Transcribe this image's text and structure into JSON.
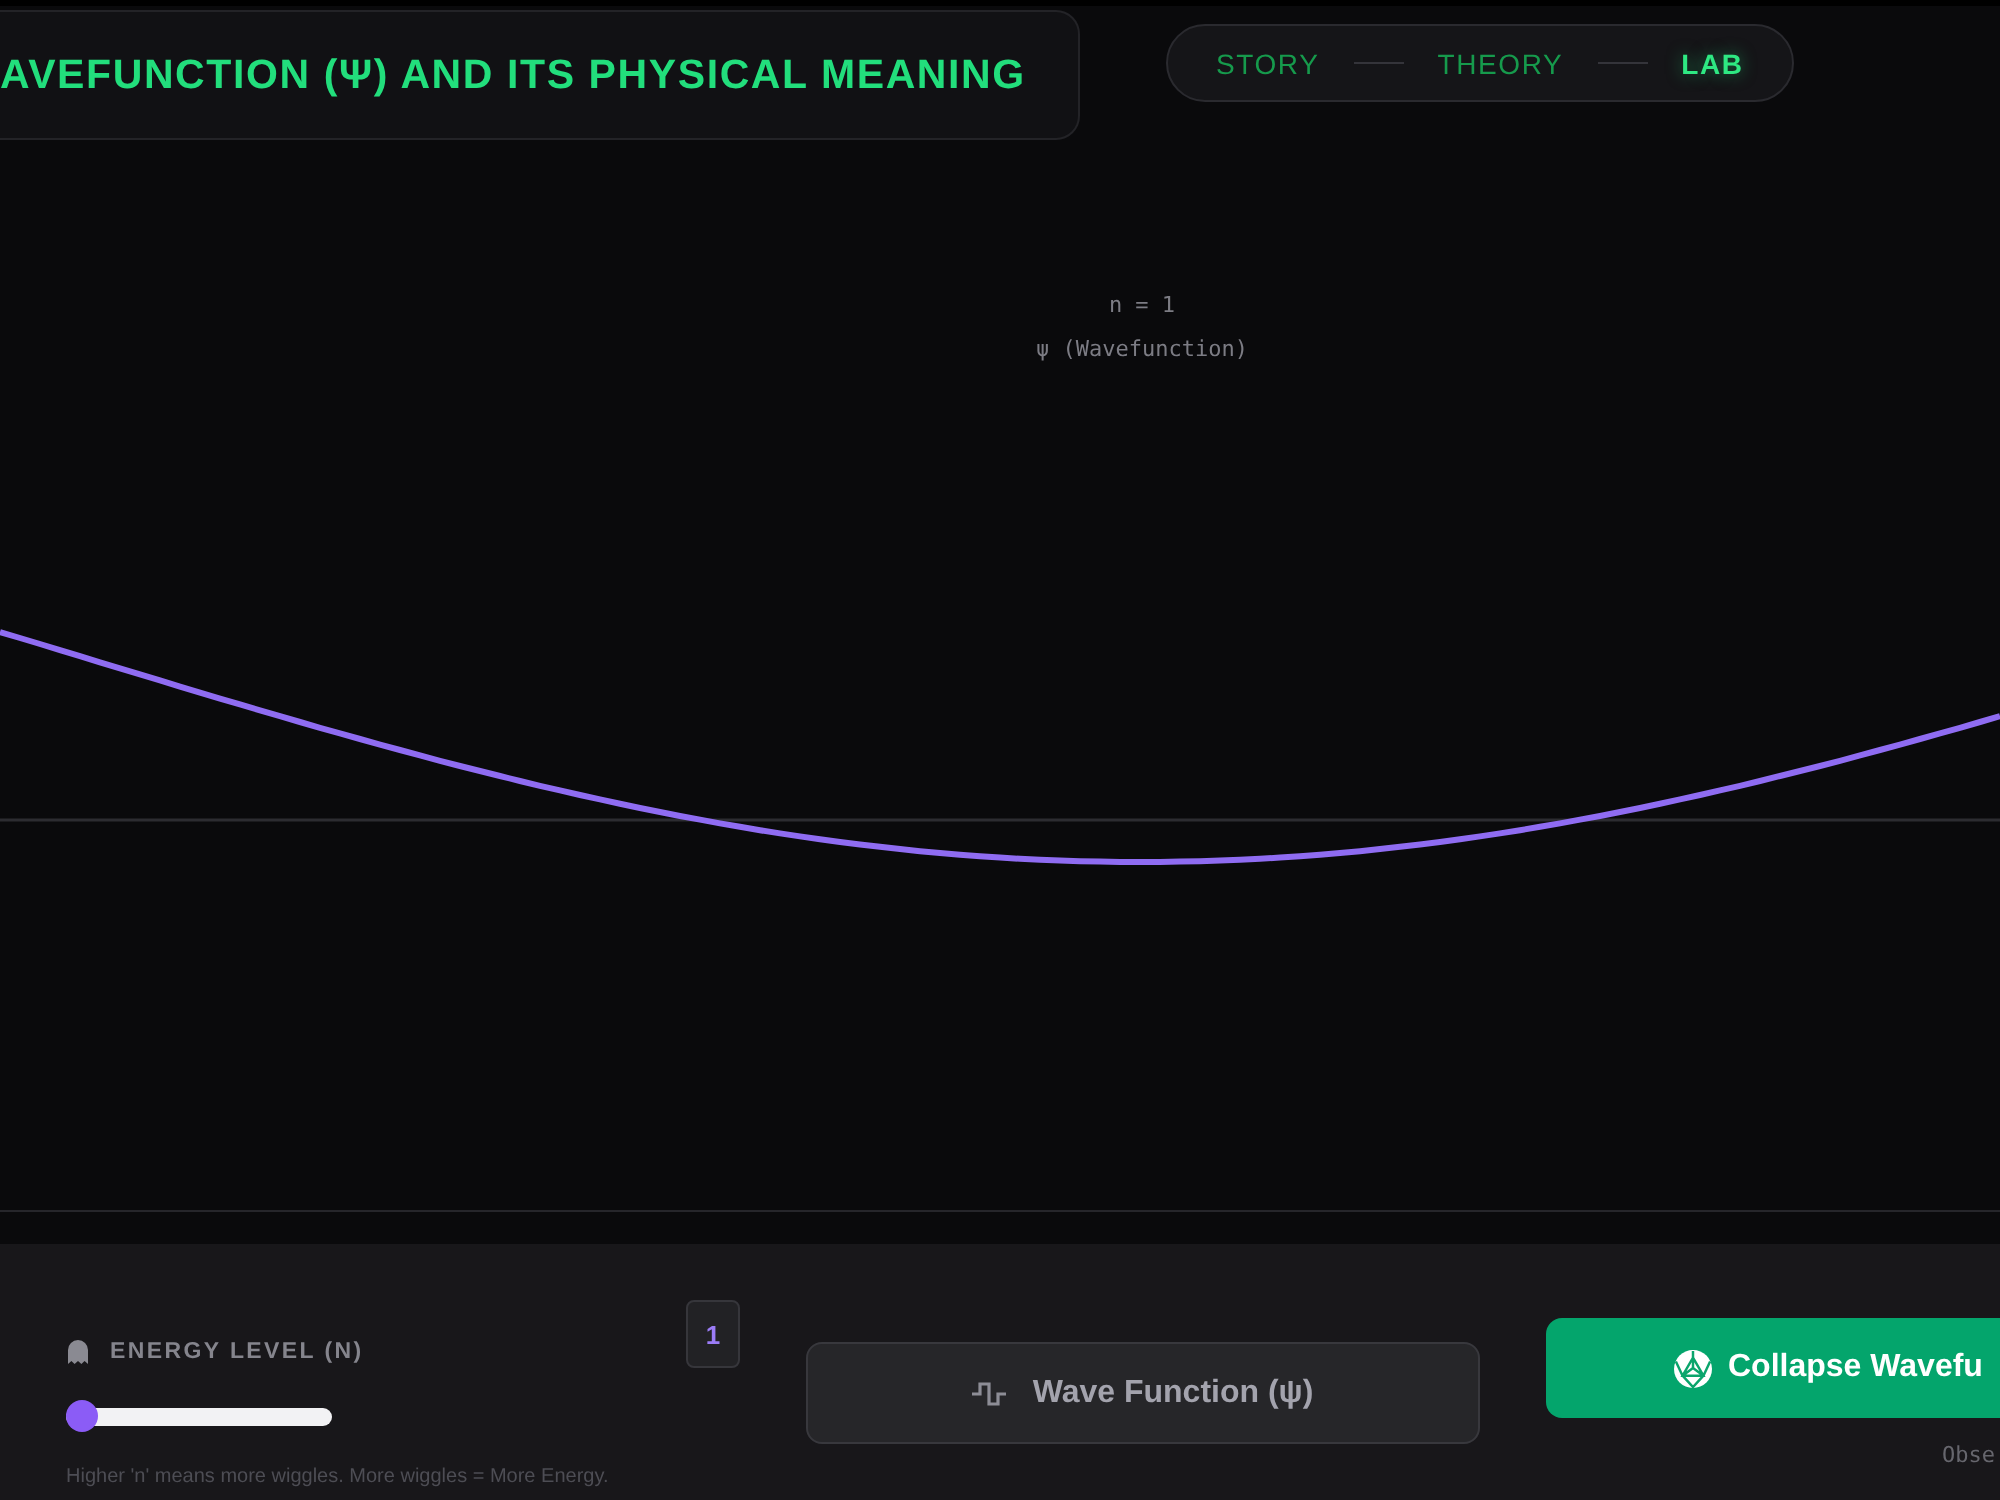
{
  "header": {
    "title": "AVEFUNCTION (Ψ) AND ITS PHYSICAL MEANING"
  },
  "nav": {
    "steps": [
      {
        "label": "STORY",
        "selected": false
      },
      {
        "label": "THEORY",
        "selected": false
      },
      {
        "label": "LAB",
        "selected": true
      }
    ]
  },
  "plot": {
    "state_label": "n = 1",
    "series_label": "ψ (Wavefunction)"
  },
  "controls": {
    "energy": {
      "label": "ENERGY LEVEL (N)",
      "value": "1",
      "level": 0,
      "hint": "Higher 'n' means more wiggles. More wiggles = More Energy."
    },
    "view_button": {
      "label": "Wave Function (ψ)"
    },
    "collapse_button": {
      "label": "Collapse Wavefu"
    },
    "collapse_note": "Obse"
  }
}
